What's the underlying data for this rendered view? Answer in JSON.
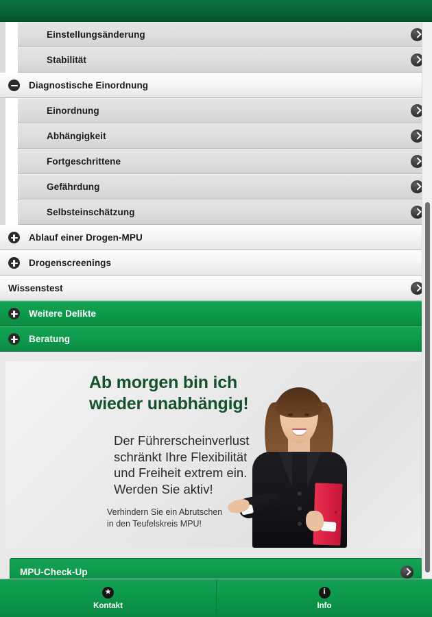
{
  "header": {
    "title": ""
  },
  "accordion": {
    "items": [
      {
        "label": "Einstellungsänderung",
        "level": "sub",
        "icon": "chevron-right-icon",
        "toggle": null
      },
      {
        "label": "Stabilität",
        "level": "sub",
        "icon": "chevron-right-icon",
        "toggle": null
      },
      {
        "label": "Diagnostische Einordnung",
        "level": "group-open",
        "icon": null,
        "toggle": "minus-icon"
      },
      {
        "label": "Einordnung",
        "level": "sub",
        "icon": "chevron-right-icon",
        "toggle": null
      },
      {
        "label": "Abhängigkeit",
        "level": "sub",
        "icon": "chevron-right-icon",
        "toggle": null
      },
      {
        "label": "Fortgeschrittene",
        "level": "sub",
        "icon": "chevron-right-icon",
        "toggle": null
      },
      {
        "label": "Gefährdung",
        "level": "sub",
        "icon": "chevron-right-icon",
        "toggle": null
      },
      {
        "label": "Selbsteinschätzung",
        "level": "sub",
        "icon": "chevron-right-icon",
        "toggle": null
      },
      {
        "label": "Ablauf einer Drogen-MPU",
        "level": "group-closed",
        "icon": null,
        "toggle": "plus-icon"
      },
      {
        "label": "Drogenscreenings",
        "level": "group-closed",
        "icon": null,
        "toggle": "plus-icon"
      },
      {
        "label": "Wissenstest",
        "level": "plain",
        "icon": "chevron-right-icon",
        "toggle": null
      },
      {
        "label": "Weitere Delikte",
        "level": "green-closed",
        "icon": null,
        "toggle": "plus-icon"
      },
      {
        "label": "Beratung",
        "level": "green-closed",
        "icon": null,
        "toggle": "plus-icon"
      }
    ]
  },
  "banner": {
    "headline": "Ab morgen bin ich\nwieder unabhängig!",
    "body": "Der Führerscheinverlust\nschränkt Ihre Flexibilität\nund Freiheit extrem ein.\nWerden Sie aktiv!",
    "subtext": "Verhindern Sie ein Abrutschen\nin den Teufelskreis MPU!",
    "image_alt": "businesswoman-with-red-folder"
  },
  "cta": {
    "label": "MPU-Check-Up",
    "icon": "chevron-right-icon"
  },
  "tabbar": {
    "tabs": [
      {
        "label": "Kontakt",
        "icon": "star-icon",
        "glyph": "★"
      },
      {
        "label": "Info",
        "icon": "info-icon",
        "glyph": "i"
      }
    ]
  },
  "colors": {
    "brand_green": "#0d9a4c",
    "header_green": "#0a6639",
    "headline_green": "#15512c",
    "folder_red": "#d81f42",
    "row_grey": "#e4e4e4"
  }
}
